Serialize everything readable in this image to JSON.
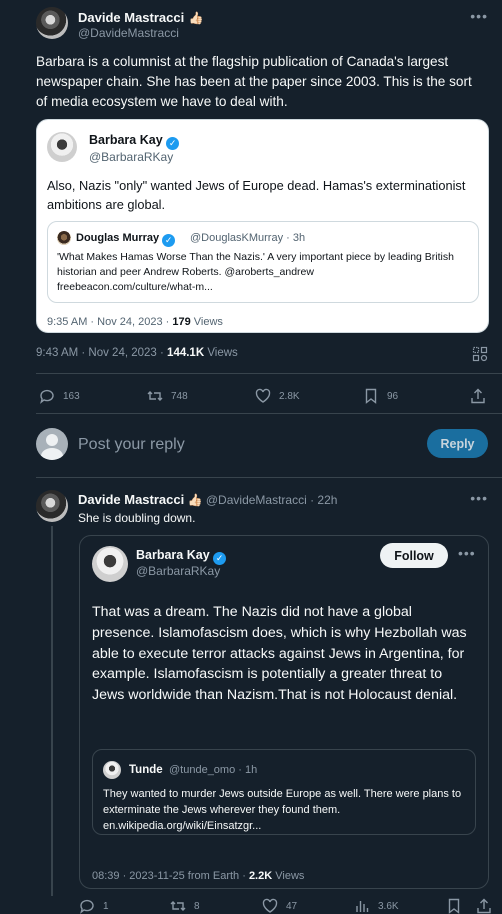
{
  "main_tweet": {
    "author_name": "Davide Mastracci",
    "author_emoji": "👍🏻",
    "author_handle": "@DavideMastracci",
    "text": "Barbara is a columnist at the flagship publication of Canada's largest newspaper chain.  She has been at the paper since 2003. This is the sort of media ecosystem we have to deal with.",
    "quote": {
      "author_name": "Barbara Kay",
      "author_handle": "@BarbaraRKay",
      "text": "Also, Nazis \"only\" wanted Jews of Europe dead. Hamas's exterminationist ambitions are global.",
      "inner_quote": {
        "author_name": "Douglas Murray",
        "author_handle": "@DouglasKMurray",
        "time": "3h",
        "text": "'What Makes Hamas Worse Than the Nazis.' A very important piece by leading British historian and peer Andrew Roberts. @aroberts_andrew",
        "link": "freebeacon.com/culture/what-m..."
      },
      "timestamp": "9:35 AM · Nov 24, 2023 · ",
      "views_count": "179",
      "views_label": " Views"
    },
    "timestamp": "9:43 AM · Nov 24, 2023 · ",
    "views_count": "144.1K",
    "views_label": " Views",
    "actions": {
      "replies": "163",
      "retweets": "748",
      "likes": "2.8K",
      "bookmarks": "96"
    }
  },
  "reply_box": {
    "placeholder": "Post your reply",
    "button_label": "Reply"
  },
  "reply_tweet": {
    "author_name": "Davide Mastracci",
    "author_emoji": "👍🏻",
    "author_handle": "@DavideMastracci",
    "time": "· 22h",
    "text": "She is doubling down.",
    "quote": {
      "author_name": "Barbara Kay",
      "author_handle": "@BarbaraRKay",
      "follow_label": "Follow",
      "text": "That was a dream. The Nazis did not have a global presence. Islamofascism does, which is why Hezbollah was able to execute terror attacks against Jews in Argentina, for example. Islamofascism is potentially a greater threat to Jews worldwide than Nazism.That is not Holocaust denial.",
      "inner_quote": {
        "author_name": "Tunde",
        "author_handle": "@tunde_omo",
        "time": "· 1h",
        "text": "They wanted to murder Jews outside Europe as well. There were plans to exterminate the Jews wherever they found them.",
        "link": "en.wikipedia.org/wiki/Einsatzgr..."
      },
      "timestamp": "08:39 · 2023-11-25 from Earth · ",
      "views_count": "2.2K",
      "views_label": " Views"
    },
    "actions": {
      "replies": "1",
      "retweets": "8",
      "likes": "47",
      "views": "3.6K"
    }
  },
  "colors": {
    "background": "#15202b",
    "accent": "#1d9bf0",
    "muted_text": "#8b98a5",
    "divider": "#38444d"
  }
}
